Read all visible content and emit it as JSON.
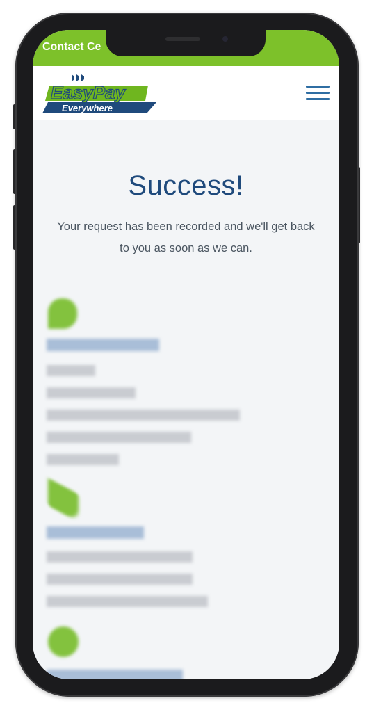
{
  "topbar": {
    "text": "Contact Ce"
  },
  "brand": {
    "line1": "EasyPay",
    "line2": "Everywhere"
  },
  "main": {
    "title": "Success!",
    "message": "Your request has been recorded and we'll get back to you as soon as we can."
  },
  "colors": {
    "accent_green": "#7dc12a",
    "brand_blue": "#1f4a7c"
  },
  "icons": [
    "menu-icon",
    "location-icon",
    "phone-icon",
    "clock-icon"
  ]
}
